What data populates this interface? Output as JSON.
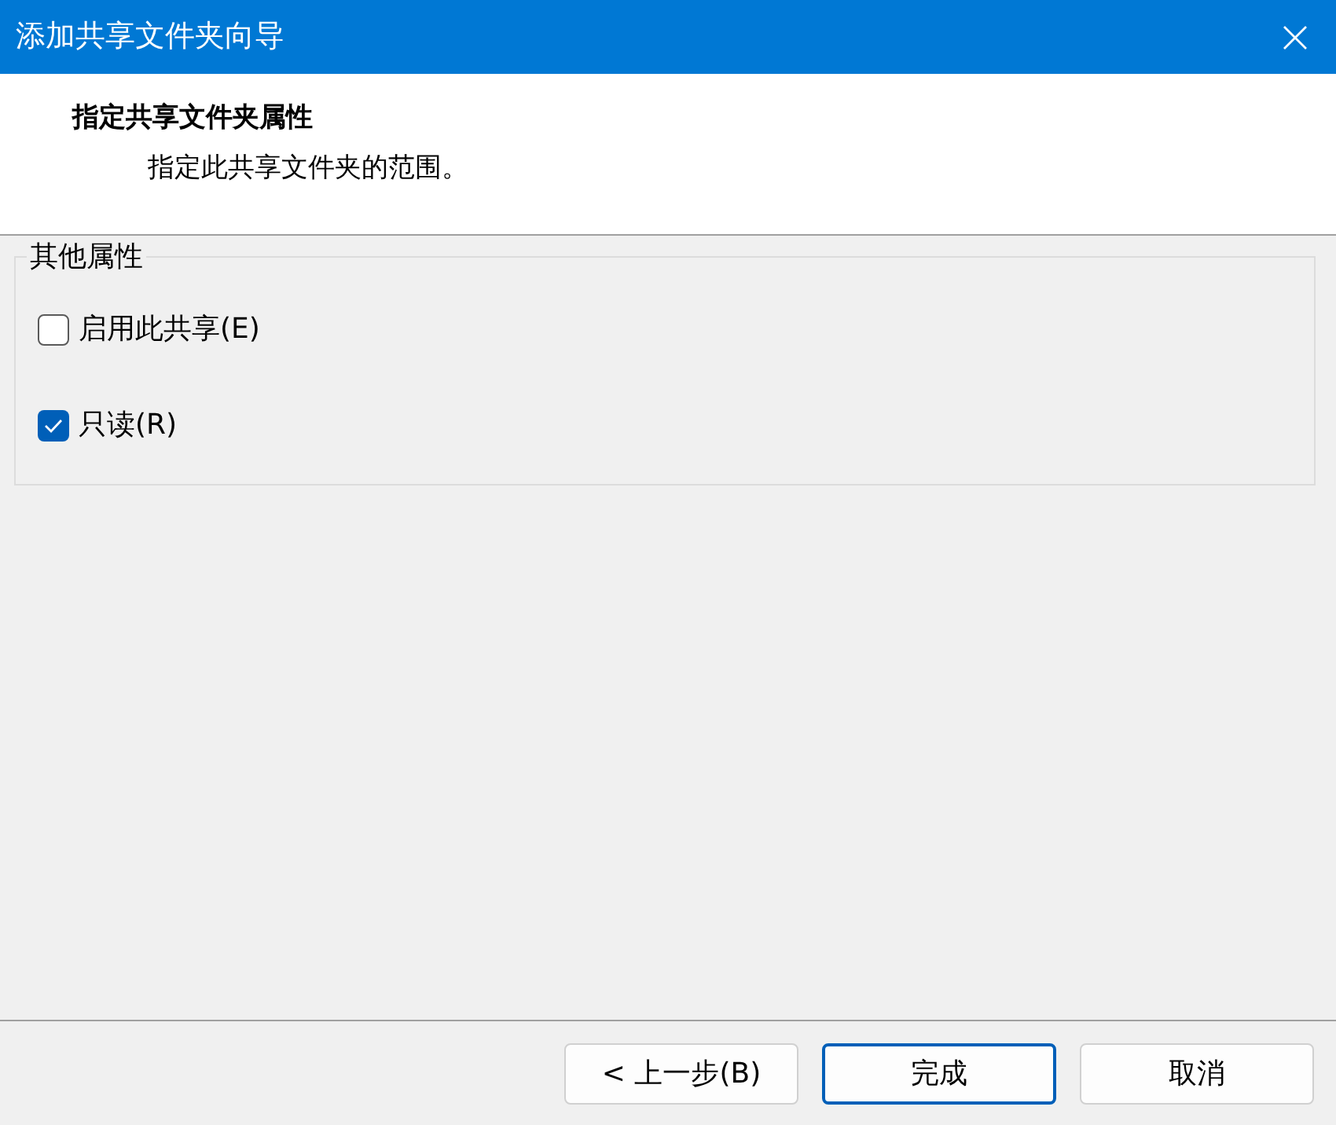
{
  "window": {
    "title": "添加共享文件夹向导"
  },
  "header": {
    "title": "指定共享文件夹属性",
    "subtitle": "指定此共享文件夹的范围。"
  },
  "group": {
    "legend": "其他属性",
    "options": [
      {
        "label": "启用此共享(E)",
        "checked": false
      },
      {
        "label": "只读(R)",
        "checked": true
      }
    ]
  },
  "buttons": [
    {
      "label": "< 上一步(B)",
      "default": false
    },
    {
      "label": "完成",
      "default": true
    },
    {
      "label": "取消",
      "default": false
    }
  ]
}
